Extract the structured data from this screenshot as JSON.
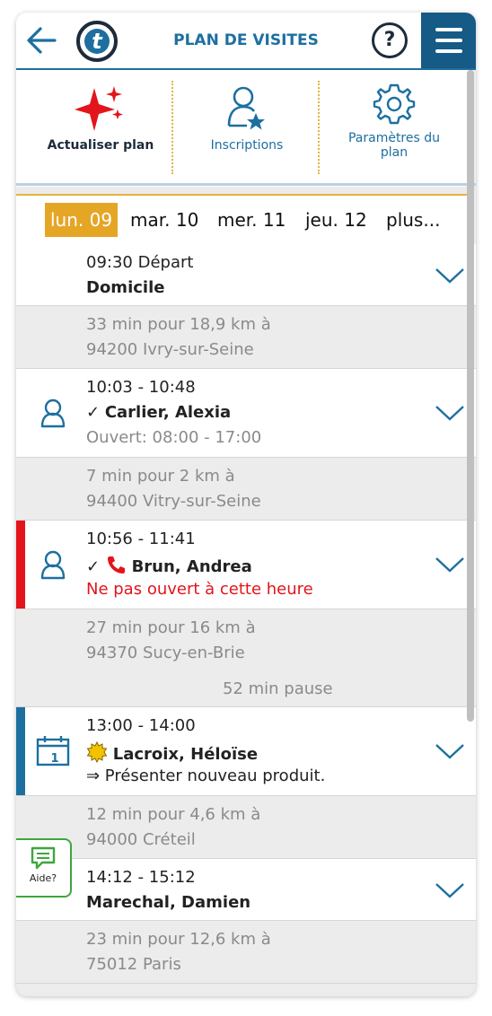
{
  "header": {
    "title": "PLAN DE VISITES",
    "help_label": "?",
    "logo_letter": "t"
  },
  "toolbar": {
    "refresh_label": "Actualiser plan",
    "registrations_label": "Inscriptions",
    "settings_label_line1": "Paramètres du",
    "settings_label_line2": "plan"
  },
  "days": [
    {
      "label": "lun. 09",
      "active": true
    },
    {
      "label": "mar. 10"
    },
    {
      "label": "mer. 11"
    },
    {
      "label": "jeu. 12"
    },
    {
      "label": "plus..."
    }
  ],
  "entries": [
    {
      "type": "visit",
      "time": "09:30 Départ",
      "name": "Domicile"
    },
    {
      "type": "travel",
      "line1": "33 min pour 18,9 km à",
      "line2": "94200 Ivry-sur-Seine"
    },
    {
      "type": "visit",
      "time": "10:03 - 10:48",
      "check": "✓",
      "name": "Carlier, Alexia",
      "note": "Ouvert: 08:00 - 17:00"
    },
    {
      "type": "travel",
      "line1": "7 min pour 2 km à",
      "line2": "94400 Vitry-sur-Seine"
    },
    {
      "type": "visit",
      "time": "10:56 - 11:41",
      "check": "✓",
      "name": "Brun, Andrea",
      "note": "Ne pas ouvert à cette heure",
      "strip_color": "#e3141b"
    },
    {
      "type": "travel",
      "line1": "27 min pour 16 km à",
      "line2": "94370 Sucy-en-Brie",
      "pause": "52 min pause"
    },
    {
      "type": "visit",
      "time": "13:00 - 14:00",
      "name": "Lacroix, Héloïse",
      "note": "⇒ Présenter nouveau produit.",
      "strip_color": "#1d6fa0",
      "calendar_day": "1"
    },
    {
      "type": "travel",
      "line1": "12 min pour 4,6 km à",
      "line2": "94000 Créteil"
    },
    {
      "type": "visit",
      "time": "14:12 - 15:12",
      "name": "Marechal, Damien"
    },
    {
      "type": "travel",
      "line1": "23 min pour 12,6 km à",
      "line2": "75012 Paris"
    }
  ],
  "help_widget": {
    "label": "Aide?"
  },
  "colors": {
    "accent": "#1d6fa0",
    "highlight": "#e5a626",
    "alert": "#e3141b",
    "help": "#3ea63e"
  }
}
